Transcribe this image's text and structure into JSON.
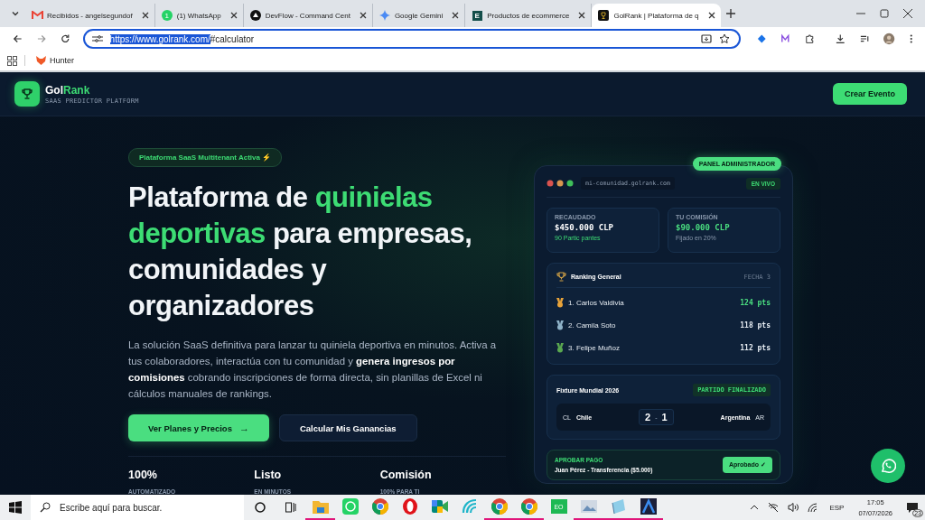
{
  "browser": {
    "tabs": [
      {
        "title": "Recibidos - angelsegundof",
        "kind": "gmail",
        "selected": false
      },
      {
        "title": "(1) WhatsApp",
        "kind": "whatsapp",
        "selected": false
      },
      {
        "title": "DevFlow - Command Cent",
        "kind": "devflow",
        "selected": false
      },
      {
        "title": "Google Gemini",
        "kind": "gemini",
        "selected": false
      },
      {
        "title": "Productos de ecommerce",
        "kind": "ebox",
        "selected": false
      },
      {
        "title": "GolRank | Plataforma de q",
        "kind": "trophy",
        "selected": true
      }
    ],
    "whatsapp_badge": "1",
    "ebox_letter": "E",
    "url": {
      "highlighted": "https://www.golrank.com/",
      "rest": "#calculator"
    },
    "bookmarks": [
      {
        "label": "Hunter"
      }
    ]
  },
  "header": {
    "brand_main": "Gol",
    "brand_accent": "Rank",
    "tagline": "SAAS PREDICTOR PLATFORM",
    "cta": "Crear Evento"
  },
  "hero": {
    "badge": "Plataforma SaaS Multitenant Activa ⚡",
    "headline": [
      {
        "text": "Plataforma de ",
        "accent": false
      },
      {
        "text": "quinielas deportivas",
        "accent": true
      },
      {
        "text": " para empresas, comunidades y organizadores",
        "accent": false
      }
    ],
    "description": "La solución SaaS definitiva para lanzar tu quiniela deportiva en minutos. Activa a tus colaboradores, interactúa con tu comunidad y **genera ingresos por comisiones** cobrando inscripciones de forma directa, sin planillas de Excel ni cálculos manuales de rankings.",
    "buttons": [
      {
        "label": "Ver Planes y Precios",
        "kind": "primary",
        "arrow": "→"
      },
      {
        "label": "Calcular Mis Ganancias",
        "kind": "secondary"
      }
    ],
    "stats": [
      {
        "value": "100%",
        "label": "AUTOMATIZADO"
      },
      {
        "value": "Listo",
        "label": "EN MINUTOS"
      },
      {
        "value": "Comisión",
        "label": "100% PARA TI"
      }
    ]
  },
  "panel": {
    "badge": "PANEL ADMINISTRADOR",
    "url": "mi-comunidad.golrank.com",
    "live": "EN VIVO",
    "metrics": [
      {
        "label": "RECAUDADO",
        "value": "$450.000 CLP",
        "note": "90 Partic pantes",
        "accent": false
      },
      {
        "label": "TU COMISIÓN",
        "value": "$90.000 CLP",
        "note": "Fijado en 20%",
        "accent": true
      }
    ],
    "ranking": {
      "title": "Ranking General",
      "round": "FECHA 3",
      "rows": [
        {
          "name": "1. Carlos Valdivia",
          "points": "124 pts",
          "leader": true,
          "color": "#e8a33a"
        },
        {
          "name": "2. Camila Soto",
          "points": "118 pts",
          "leader": false,
          "color": "#8fb3c9"
        },
        {
          "name": "3. Felipe Muñoz",
          "points": "112 pts",
          "leader": false,
          "color": "#5aa850"
        }
      ]
    },
    "fixture": {
      "title": "Fixture Mundial 2026",
      "status": "PARTIDO FINALIZADO",
      "home": {
        "code": "CL",
        "name": "Chile"
      },
      "score_home": "2",
      "separator": "-",
      "score_away": "1",
      "away": {
        "code": "AR",
        "name": "Argentina"
      }
    },
    "payment": {
      "label": "APROBAR PAGO",
      "detail": "Juan Pérez - Transferencia ($5.000)",
      "button": "Aprobado ✓"
    }
  },
  "taskbar": {
    "search_placeholder": "Escribe aquí para buscar.",
    "apps": [
      {
        "kind": "files",
        "open": true
      },
      {
        "kind": "whatsapp",
        "open": false
      },
      {
        "kind": "chrome",
        "open": false
      },
      {
        "kind": "opera",
        "open": false
      },
      {
        "kind": "meet",
        "open": false
      },
      {
        "kind": "wave",
        "open": false
      },
      {
        "kind": "chrome",
        "open": true
      },
      {
        "kind": "chrome",
        "open": true
      },
      {
        "kind": "eo",
        "open": false,
        "text": "EO"
      },
      {
        "kind": "photos",
        "open": true
      },
      {
        "kind": "notepad",
        "open": true
      },
      {
        "kind": "arc",
        "open": true
      }
    ],
    "language": "ESP",
    "time": "17:05",
    "date": "07/07/2026",
    "notifications": "23"
  }
}
